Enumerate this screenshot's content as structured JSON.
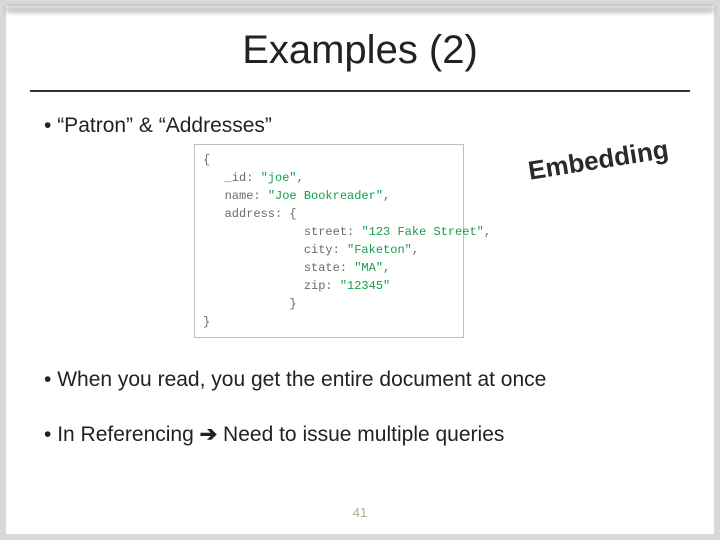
{
  "title": "Examples (2)",
  "bullet1_prefix": "•  ",
  "bullet1": "“Patron” & “Addresses”",
  "bullet2_prefix": "•  ",
  "bullet2": "When you read, you get the entire document at once",
  "bullet3_prefix": "•  ",
  "bullet3_part1": "In Referencing ",
  "bullet3_arrow": "➔",
  "bullet3_part2": " Need to issue multiple queries",
  "annotation": "Embedding",
  "page_number": "41",
  "code": {
    "l1a": "{",
    "l2a": "   _id: ",
    "l2b": "\"joe\"",
    "l2c": ",",
    "l3a": "   name: ",
    "l3b": "\"Joe Bookreader\"",
    "l3c": ",",
    "l4a": "   address: {",
    "l5a": "              street: ",
    "l5b": "\"123 Fake Street\"",
    "l5c": ",",
    "l6a": "              city: ",
    "l6b": "\"Faketon\"",
    "l6c": ",",
    "l7a": "              state: ",
    "l7b": "\"MA\"",
    "l7c": ",",
    "l8a": "              zip: ",
    "l8b": "\"12345\"",
    "l9a": "            }",
    "l10a": "}"
  }
}
